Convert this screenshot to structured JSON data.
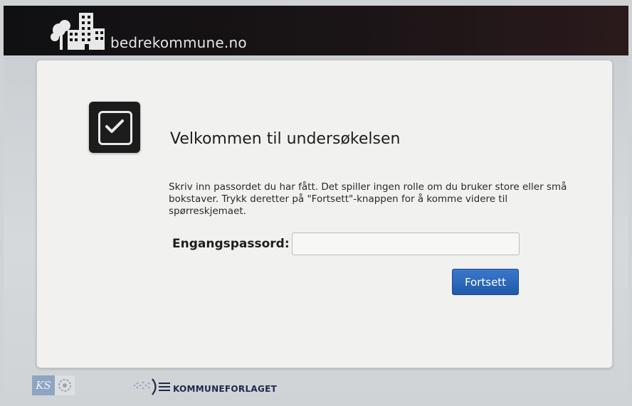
{
  "header": {
    "site_title": "bedrekommune.no"
  },
  "card": {
    "heading": "Velkommen til undersøkelsen",
    "instructions": "Skriv inn passordet du har fått. Det spiller ingen rolle om du bruker store eller små bokstaver. Trykk deretter på \"Fortsett\"-knappen for å komme videre til spørreskjemaet.",
    "password_label": "Engangspassord:",
    "password_value": "",
    "continue_label": "Fortsett",
    "icon": "checkbox-checked-icon"
  },
  "footer": {
    "ks_logo_text": "KS",
    "publisher_name": "KOMMUNEFORLAGET"
  },
  "colors": {
    "header_bg": "#151214",
    "accent_button": "#2a66bb",
    "card_bg": "#f1f1ef"
  }
}
